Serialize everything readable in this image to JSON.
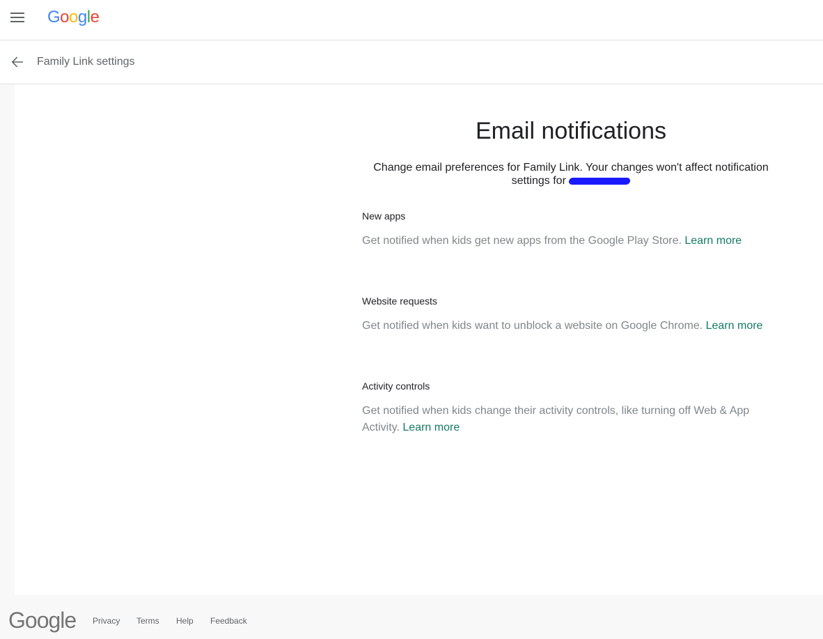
{
  "header": {
    "logo_letters": [
      "G",
      "o",
      "o",
      "g",
      "l",
      "e"
    ],
    "logo_colors": [
      "#4285F4",
      "#EA4335",
      "#FBBC05",
      "#4285F4",
      "#34A853",
      "#EA4335"
    ]
  },
  "subbar": {
    "title": "Family Link settings"
  },
  "main": {
    "heading": "Email notifications",
    "intro": "Change email preferences for Family Link. Your changes won't affect notification settings for",
    "sections": [
      {
        "title": "New apps",
        "description": "Get notified when kids get new apps from the Google Play Store.",
        "link": "Learn more"
      },
      {
        "title": "Website requests",
        "description": "Get notified when kids want to unblock a website on Google Chrome.",
        "link": "Learn more"
      },
      {
        "title": "Activity controls",
        "description": "Get notified when kids change their activity controls, like turning off Web & App Activity.",
        "link": "Learn more"
      }
    ]
  },
  "footer": {
    "logo": "Google",
    "links": [
      "Privacy",
      "Terms",
      "Help",
      "Feedback"
    ]
  },
  "colors": {
    "link": "#137a63",
    "redaction": "#1a1aff"
  }
}
